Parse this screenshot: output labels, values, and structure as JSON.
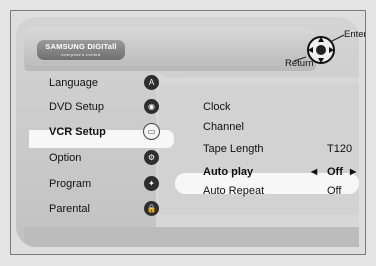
{
  "logo": {
    "brand": "SAMSUNG DIGITall",
    "tagline": "everyone's invited"
  },
  "nav_hints": {
    "enter": "Enter",
    "return": "Return"
  },
  "sidebar": {
    "items": [
      {
        "label": "Language",
        "icon": "language-icon",
        "glyph": "A"
      },
      {
        "label": "DVD Setup",
        "icon": "disc-icon",
        "glyph": "◉"
      },
      {
        "label": "VCR Setup",
        "icon": "cassette-icon",
        "glyph": "▭",
        "active": true
      },
      {
        "label": "Option",
        "icon": "option-icon",
        "glyph": "⚙"
      },
      {
        "label": "Program",
        "icon": "program-icon",
        "glyph": "✦"
      },
      {
        "label": "Parental",
        "icon": "lock-icon",
        "glyph": "🔒"
      }
    ]
  },
  "vcr_menu": {
    "clock": {
      "label": "Clock"
    },
    "channel": {
      "label": "Channel"
    },
    "tape_length": {
      "label": "Tape Length",
      "value": "T120"
    },
    "auto_play": {
      "label": "Auto play",
      "value": "Off",
      "left_arrow": "◀",
      "right_arrow": "▶"
    },
    "auto_repeat": {
      "label": "Auto Repeat",
      "value": "Off"
    }
  },
  "colors": {
    "panel": "#c9c9c9",
    "highlight": "#f7f7f7",
    "background": "#e4e4e4"
  }
}
